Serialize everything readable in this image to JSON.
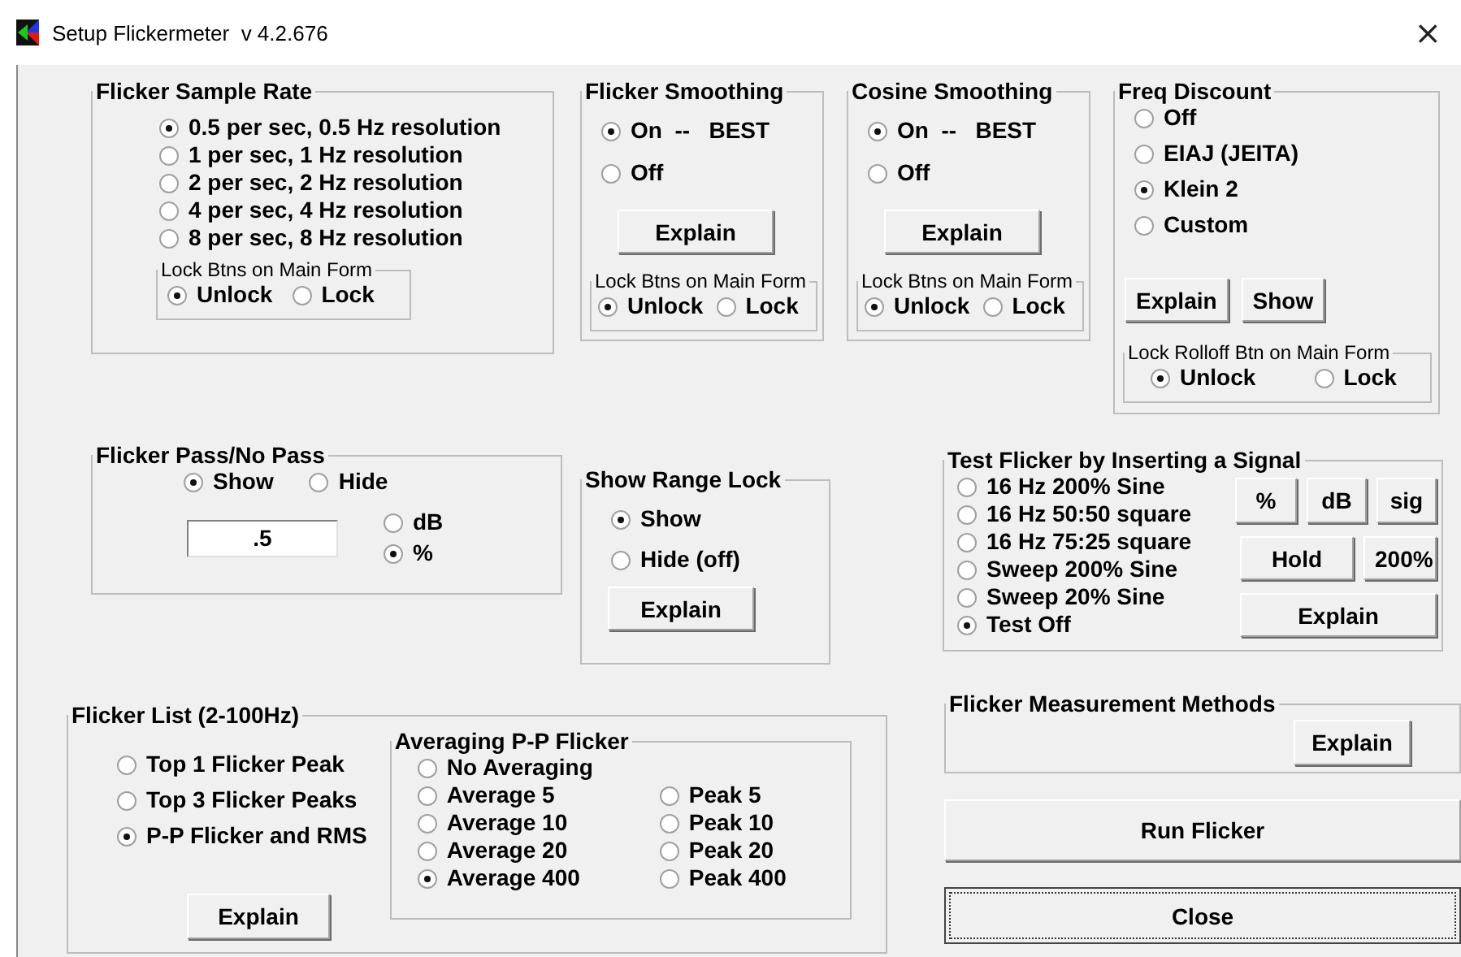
{
  "window": {
    "title": "Setup Flickermeter  v 4.2.676",
    "close": "×"
  },
  "sample_rate": {
    "title": "Flicker Sample Rate",
    "options": [
      {
        "label": "0.5 per sec, 0.5 Hz resolution",
        "selected": true
      },
      {
        "label": "1 per sec, 1 Hz resolution",
        "selected": false
      },
      {
        "label": "2 per sec, 2 Hz resolution",
        "selected": false
      },
      {
        "label": "4 per sec, 4 Hz resolution",
        "selected": false
      },
      {
        "label": "8 per sec, 8 Hz resolution",
        "selected": false
      }
    ],
    "lock": {
      "title": "Lock Btns on Main Form",
      "options": [
        {
          "label": "Unlock",
          "selected": true
        },
        {
          "label": "Lock",
          "selected": false
        }
      ]
    }
  },
  "flicker_smoothing": {
    "title": "Flicker Smoothing",
    "options": [
      {
        "label": "On  --   BEST",
        "selected": true
      },
      {
        "label": "Off",
        "selected": false
      }
    ],
    "button": "Explain",
    "lock": {
      "title": "Lock Btns on Main Form",
      "options": [
        {
          "label": "Unlock",
          "selected": true
        },
        {
          "label": "Lock",
          "selected": false
        }
      ]
    }
  },
  "cosine_smoothing": {
    "title": "Cosine Smoothing",
    "options": [
      {
        "label": "On  --   BEST",
        "selected": true
      },
      {
        "label": "Off",
        "selected": false
      }
    ],
    "button": "Explain",
    "lock": {
      "title": "Lock Btns on Main Form",
      "options": [
        {
          "label": "Unlock",
          "selected": true
        },
        {
          "label": "Lock",
          "selected": false
        }
      ]
    }
  },
  "freq_discount": {
    "title": "Freq Discount",
    "options": [
      {
        "label": "Off",
        "selected": false
      },
      {
        "label": "EIAJ (JEITA)",
        "selected": false
      },
      {
        "label": "Klein 2",
        "selected": true
      },
      {
        "label": "Custom",
        "selected": false
      }
    ],
    "buttons": [
      "Explain",
      "Show"
    ],
    "lock": {
      "title": "Lock Rolloff Btn on Main Form",
      "options": [
        {
          "label": "Unlock",
          "selected": true
        },
        {
          "label": "Lock",
          "selected": false
        }
      ]
    }
  },
  "pass_no_pass": {
    "title": "Flicker Pass/No Pass",
    "visibility": [
      {
        "label": "Show",
        "selected": true
      },
      {
        "label": "Hide",
        "selected": false
      }
    ],
    "value": ".5",
    "units": [
      {
        "label": "dB",
        "selected": false
      },
      {
        "label": "%",
        "selected": true
      }
    ]
  },
  "range_lock": {
    "title": "Show Range Lock",
    "options": [
      {
        "label": "Show",
        "selected": true
      },
      {
        "label": "Hide (off)",
        "selected": false
      }
    ],
    "button": "Explain"
  },
  "test_signal": {
    "title": "Test Flicker by Inserting a Signal",
    "options": [
      {
        "label": "16 Hz 200% Sine",
        "selected": false
      },
      {
        "label": "16 Hz 50:50 square",
        "selected": false
      },
      {
        "label": "16 Hz 75:25 square",
        "selected": false
      },
      {
        "label": "Sweep 200% Sine",
        "selected": false
      },
      {
        "label": "Sweep 20% Sine",
        "selected": false
      },
      {
        "label": "Test Off",
        "selected": true
      }
    ],
    "buttons": [
      "%",
      "dB",
      "sig",
      "Hold",
      "200%",
      "Explain"
    ]
  },
  "flicker_list": {
    "title": "Flicker List (2-100Hz)",
    "options": [
      {
        "label": "Top 1 Flicker Peak",
        "selected": false
      },
      {
        "label": "Top 3 Flicker Peaks",
        "selected": false
      },
      {
        "label": "P-P Flicker and RMS",
        "selected": true
      }
    ],
    "button": "Explain",
    "averaging": {
      "title": "Averaging P-P Flicker",
      "options": [
        {
          "label": "No Averaging",
          "selected": false
        },
        {
          "label": "Average 5",
          "selected": false
        },
        {
          "label": "Peak 5",
          "selected": false
        },
        {
          "label": "Average 10",
          "selected": false
        },
        {
          "label": "Peak 10",
          "selected": false
        },
        {
          "label": "Average 20",
          "selected": false
        },
        {
          "label": "Peak 20",
          "selected": false
        },
        {
          "label": "Average 400",
          "selected": true
        },
        {
          "label": "Peak 400",
          "selected": false
        }
      ]
    }
  },
  "measurement_methods": {
    "title": "Flicker Measurement Methods",
    "button": "Explain"
  },
  "run_button": "Run Flicker",
  "close_button": "Close"
}
